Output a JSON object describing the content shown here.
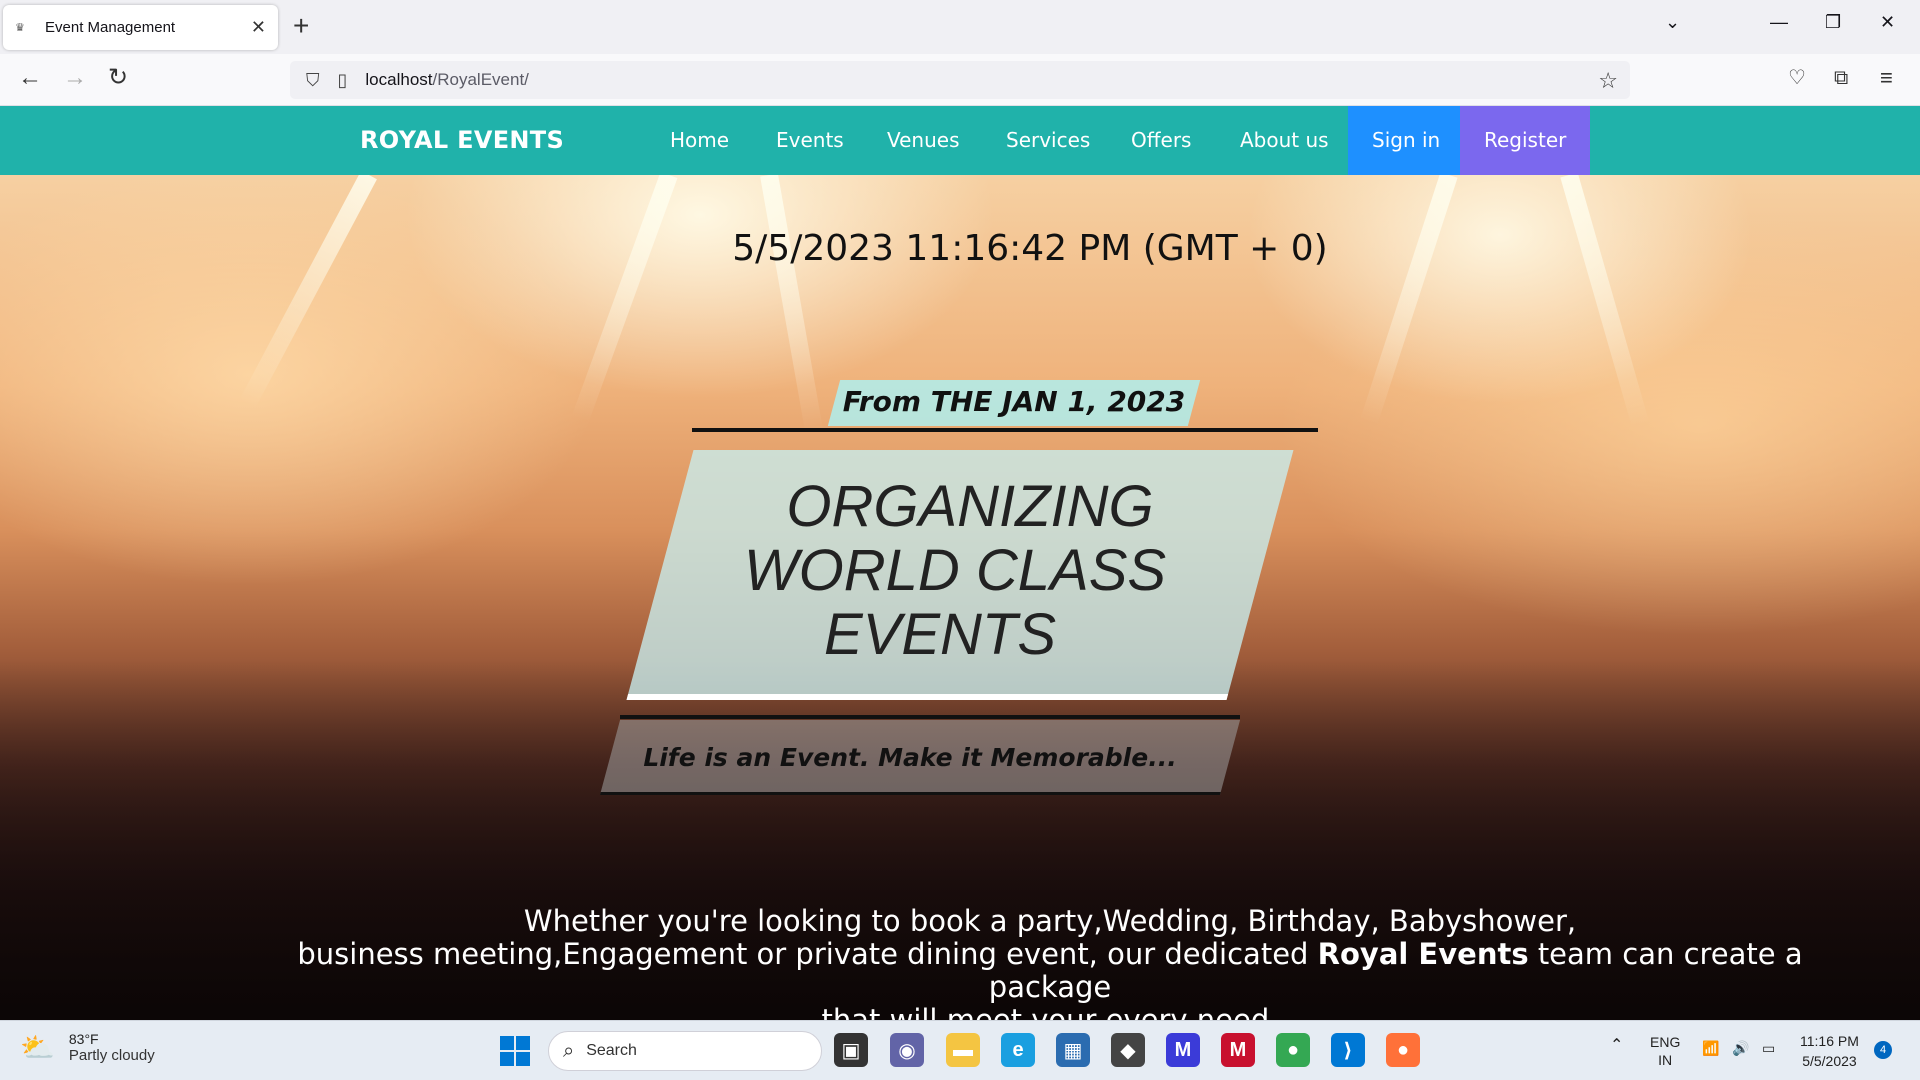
{
  "browser": {
    "tab_title": "Event Management",
    "url_host": "localhost",
    "url_path": "/RoyalEvent/"
  },
  "site": {
    "brand": "ROYAL EVENTS",
    "menu": [
      {
        "label": "Home"
      },
      {
        "label": "Events"
      },
      {
        "label": "Venues"
      },
      {
        "label": "Services"
      },
      {
        "label": "Offers"
      },
      {
        "label": "About us"
      },
      {
        "label": "Sign in"
      },
      {
        "label": "Register"
      }
    ]
  },
  "hero": {
    "datetime": "5/5/2023 11:16:42 PM (GMT + 0)",
    "from_text": "From THE JAN 1, 2023",
    "heading_lines": [
      "ORGANIZING",
      "WORLD CLASS",
      "EVENTS"
    ],
    "tagline": "Life is an Event. Make it Memorable...",
    "desc_line1": "Whether you're looking to book a party,Wedding, Birthday, Babyshower,",
    "desc_line2_pre": "business meeting,Engagement or private dining event, our dedicated",
    "desc_brand": "Royal Events",
    "desc_line2_post": "team can create a package",
    "desc_line3": "that will meet your every need."
  },
  "taskbar": {
    "weather_temp": "83°F",
    "weather_cond": "Partly cloudy",
    "search_placeholder": "Search",
    "lang_top": "ENG",
    "lang_bottom": "IN",
    "time": "11:16 PM",
    "date": "5/5/2023",
    "notification_count": "4"
  },
  "colors": {
    "header_bg": "#20b2aa",
    "signin_bg": "#1e90ff",
    "register_bg": "#7b68ee",
    "from_box": "#afeeee"
  }
}
